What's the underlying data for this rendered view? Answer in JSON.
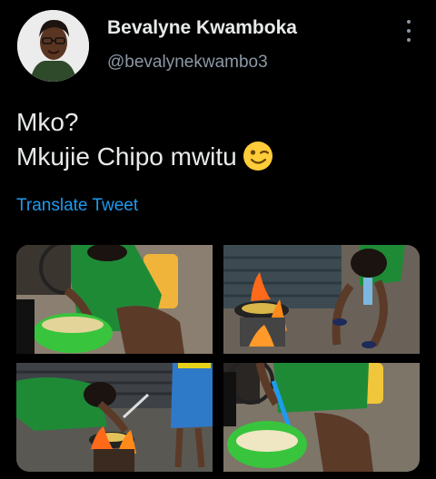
{
  "author": {
    "display_name": "Bevalyne Kwamboka",
    "handle": "@bevalynekwambo3",
    "avatar_icon": "profile-photo"
  },
  "tweet": {
    "lines": [
      "Mko?",
      "Mkujie Chipo mwitu"
    ],
    "emoji": "winking-face",
    "translate_label": "Translate Tweet"
  },
  "media": {
    "photos": [
      {
        "name": "woman-washing-potatoes-in-green-basket"
      },
      {
        "name": "woman-frying-chips-over-fire"
      },
      {
        "name": "woman-frying-chips-with-blue-skirt-person"
      },
      {
        "name": "hand-holding-basket-of-chips"
      }
    ]
  },
  "colors": {
    "background": "#000000",
    "primary_text": "#e7e9ea",
    "secondary_text": "#8b98a5",
    "link": "#1d9bf0"
  }
}
